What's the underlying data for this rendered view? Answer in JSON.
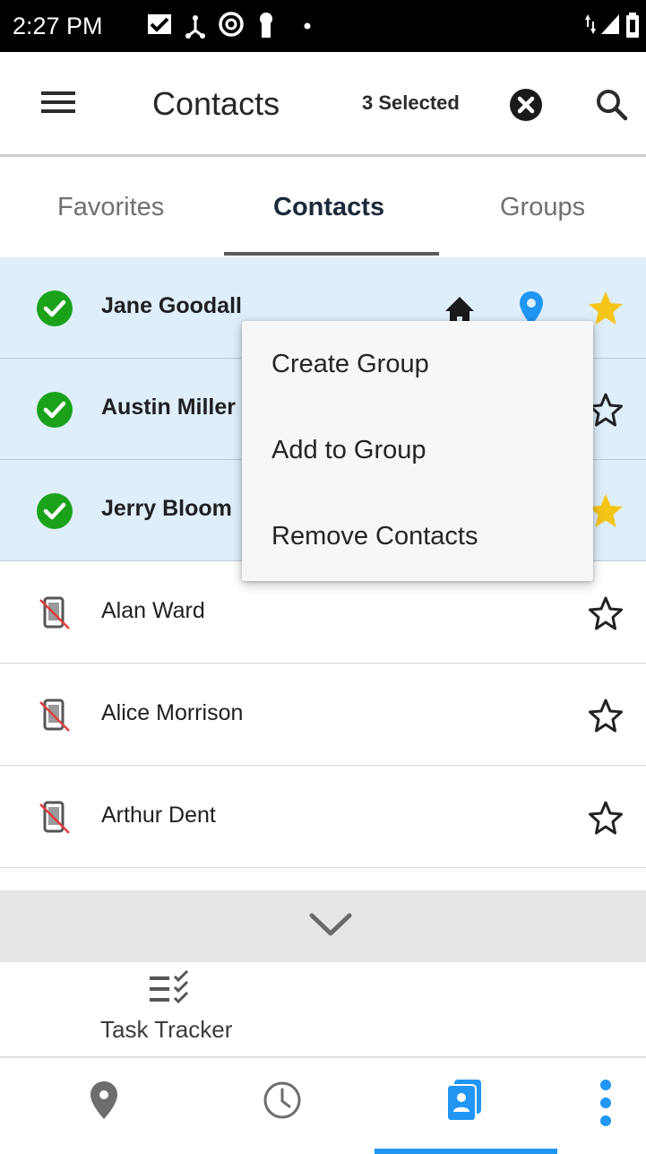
{
  "status_bar": {
    "time": "2:27 PM",
    "icons": [
      "messages-icon",
      "usb-icon",
      "at-sign-icon",
      "keyhole-icon",
      "dot-icon",
      "data-arrows-icon",
      "signal-icon",
      "battery-icon"
    ]
  },
  "app_bar": {
    "title": "Contacts",
    "selected_count": "3 Selected",
    "icons": [
      "menu-icon",
      "clear-selection-icon",
      "search-icon"
    ]
  },
  "tabs": [
    {
      "label": "Favorites",
      "active": false
    },
    {
      "label": "Contacts",
      "active": true
    },
    {
      "label": "Groups",
      "active": false
    }
  ],
  "contacts": [
    {
      "name": "Jane Goodall",
      "selected": true,
      "favorite": true,
      "home": true,
      "location": true
    },
    {
      "name": "Austin Miller",
      "selected": true,
      "favorite": false
    },
    {
      "name": "Jerry Bloom",
      "selected": true,
      "favorite": true
    },
    {
      "name": "Alan Ward",
      "selected": false,
      "favorite": false
    },
    {
      "name": "Alice Morrison",
      "selected": false,
      "favorite": false
    },
    {
      "name": "Arthur Dent",
      "selected": false,
      "favorite": false
    }
  ],
  "context_menu": {
    "items": [
      "Create Group",
      "Add to Group",
      "Remove Contacts"
    ]
  },
  "task_tracker": {
    "label": "Task Tracker"
  },
  "bottom_nav": {
    "items": [
      "map-pin-icon",
      "history-icon",
      "contacts-icon",
      "more-icon"
    ],
    "active": "contacts-icon"
  },
  "colors": {
    "selected_row": "#dfeefb",
    "check_green": "#1aa31a",
    "star_gold": "#f5c518",
    "accent_blue": "#2196f3"
  }
}
